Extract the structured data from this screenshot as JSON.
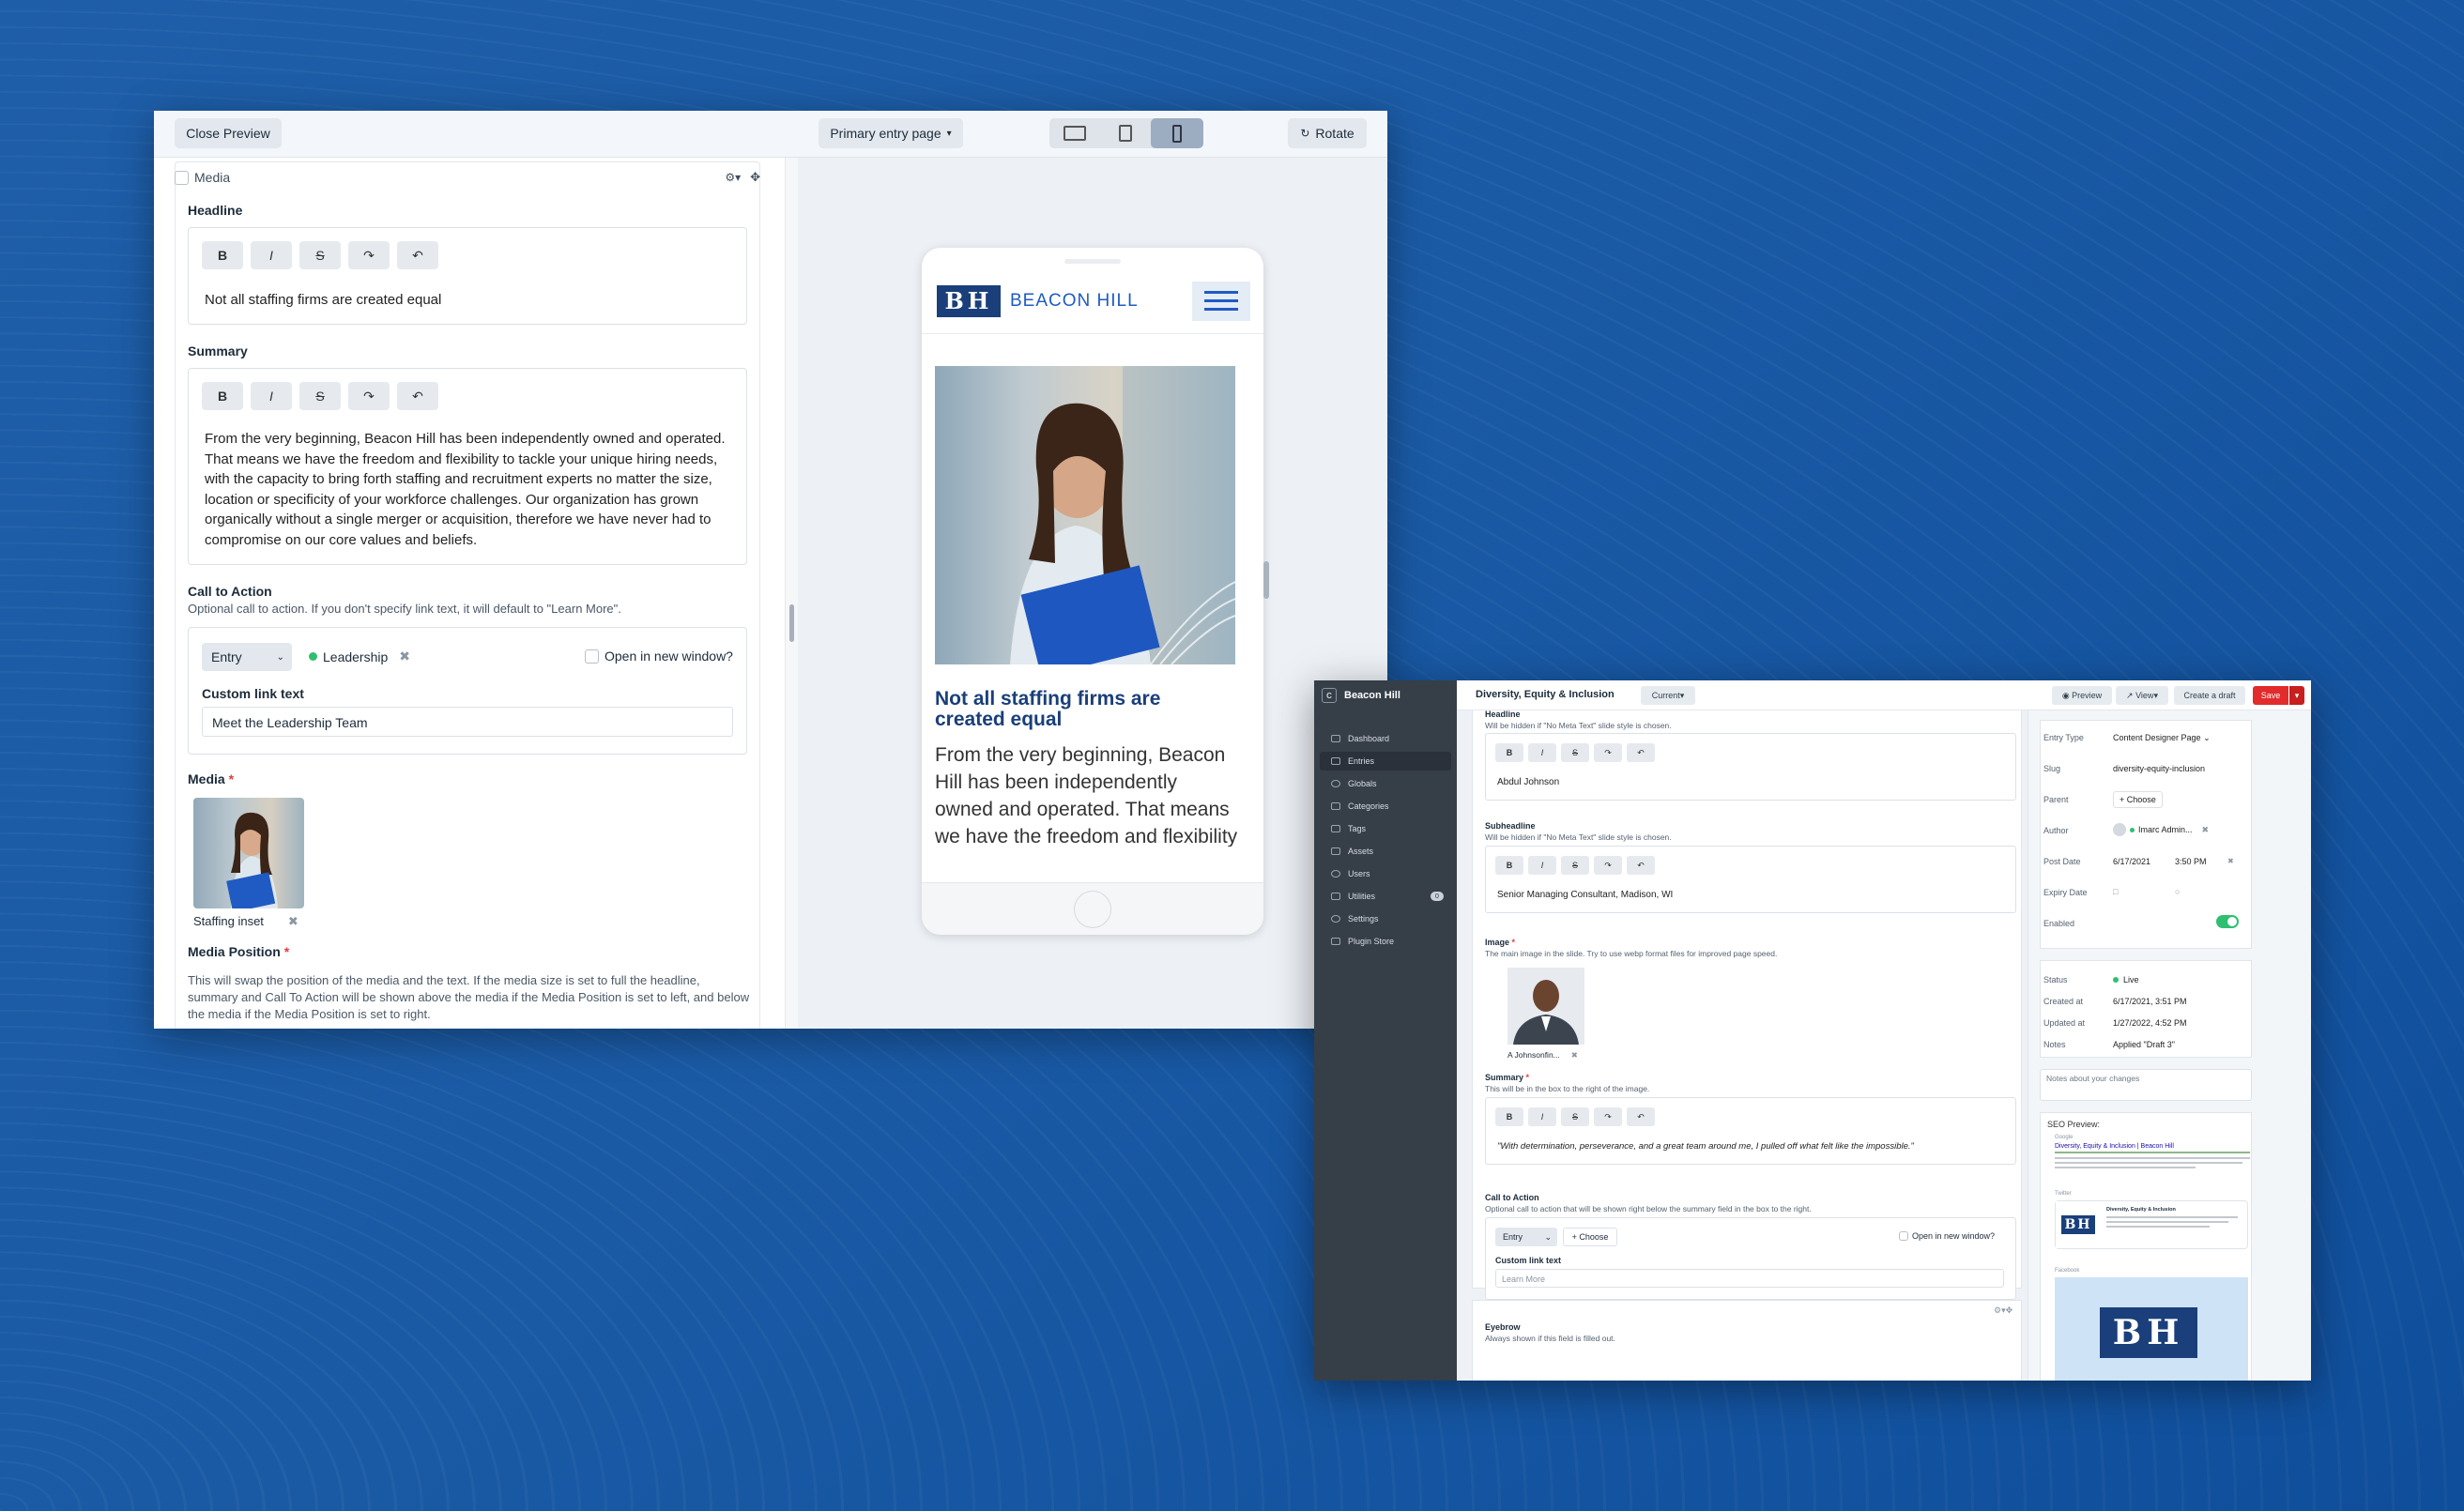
{
  "preview_window": {
    "close_label": "Close Preview",
    "page_select": "Primary entry page",
    "rotate_label": "Rotate",
    "block_label": "Media",
    "headline": {
      "label": "Headline",
      "value": "Not all staffing firms are created equal"
    },
    "summary": {
      "label": "Summary",
      "value": "From the very beginning, Beacon Hill has been independently owned and operated. That means we have the freedom and flexibility to tackle your unique hiring needs, with the capacity to bring forth staffing and recruitment experts no matter the size, location or specificity of your workforce challenges. Our organization has grown organically without a single merger or acquisition, therefore we have never had to compromise on our core values and beliefs."
    },
    "cta": {
      "label": "Call to Action",
      "hint": "Optional call to action. If you don't specify link text, it will default to \"Learn More\".",
      "type": "Entry",
      "entry": "Leadership",
      "new_window": "Open in new window?",
      "custom_label": "Custom link text",
      "custom_value": "Meet the Leadership Team"
    },
    "media": {
      "label": "Media",
      "asset": "Staffing inset"
    },
    "media_position": {
      "label": "Media Position",
      "hint": "This will swap the position of the media and the text. If the media size is set to full the headline, summary and Call To Action will be shown above the media if the Media Position is set to left, and below the media if the Media Position is set to right."
    },
    "phone": {
      "brand": "BEACON HILL",
      "logo": "BH",
      "headline": "Not all staffing firms are created equal",
      "body": "From the very beginning, Beacon Hill has been independently owned and operated. That means we have the freedom and flexibility to"
    }
  },
  "cms_window": {
    "site": "Beacon Hill",
    "title": "Diversity, Equity & Inclusion",
    "revision": "Current",
    "preview": "Preview",
    "view": "View",
    "create_draft": "Create a draft",
    "save": "Save",
    "nav": [
      "Dashboard",
      "Entries",
      "Globals",
      "Categories",
      "Tags",
      "Assets",
      "Users",
      "Utilities",
      "Settings",
      "Plugin Store"
    ],
    "utilities_badge": "0",
    "headline": {
      "label": "Headline",
      "hint": "Will be hidden if \"No Meta Text\" slide style is chosen.",
      "value": "Abdul Johnson"
    },
    "subheadline": {
      "label": "Subheadline",
      "hint": "Will be hidden if \"No Meta Text\" slide style is chosen.",
      "value": "Senior Managing Consultant, Madison, WI"
    },
    "image": {
      "label": "Image",
      "hint": "The main image in the slide. Try to use webp format files for improved page speed.",
      "asset": "A Johnsonfin..."
    },
    "summary": {
      "label": "Summary",
      "hint": "This will be in the box to the right of the image.",
      "value": "\"With determination, perseverance, and a great team around me, I pulled off what felt like the impossible.\""
    },
    "cta": {
      "label": "Call to Action",
      "hint": "Optional call to action that will be shown right below the summary field in the box to the right.",
      "type": "Entry",
      "choose": "+ Choose",
      "new_window": "Open in new window?",
      "custom_label": "Custom link text",
      "placeholder": "Learn More"
    },
    "eyebrow": {
      "label": "Eyebrow",
      "hint": "Always shown if this field is filled out."
    },
    "meta": {
      "entry_type_label": "Entry Type",
      "entry_type": "Content Designer Page",
      "slug_label": "Slug",
      "slug": "diversity-equity-inclusion",
      "parent_label": "Parent",
      "parent": "+ Choose",
      "author_label": "Author",
      "author": "Imarc Admin...",
      "post_date_label": "Post Date",
      "post_date": "6/17/2021",
      "post_time": "3:50 PM",
      "expiry_label": "Expiry Date",
      "enabled_label": "Enabled"
    },
    "status": {
      "status_label": "Status",
      "status": "Live",
      "created_label": "Created at",
      "created": "6/17/2021, 3:51 PM",
      "updated_label": "Updated at",
      "updated": "1/27/2022, 4:52 PM",
      "notes_label": "Notes",
      "notes": "Applied \"Draft 3\""
    },
    "notes_placeholder": "Notes about your changes",
    "seo": {
      "label": "SEO Preview:",
      "google": "Google",
      "google_title": "Diversity, Equity & Inclusion | Beacon Hill",
      "twitter": "Twitter",
      "twitter_title": "Diversity, Equity & Inclusion",
      "facebook": "Facebook"
    }
  },
  "colors": {
    "accent": "#1a3f7a",
    "save": "#e22b2b",
    "live": "#2fbf71"
  }
}
